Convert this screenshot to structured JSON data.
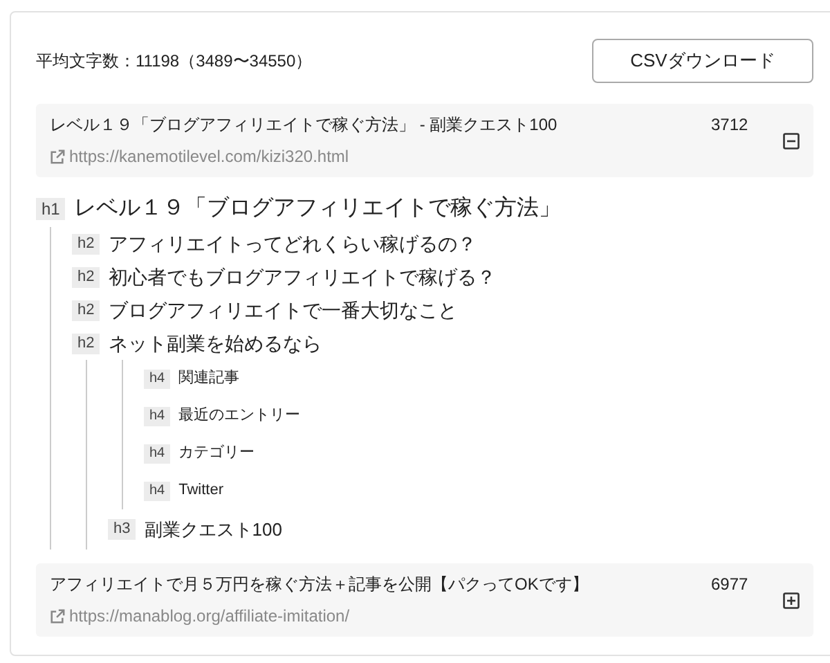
{
  "summary": "平均文字数：11198（3489〜34550）",
  "csv_button": "CSVダウンロード",
  "articles": [
    {
      "title": "レベル１９「ブログアフィリエイトで稼ぐ方法」 - 副業クエスト100",
      "url": "https://kanemotilevel.com/kizi320.html",
      "count": "3712",
      "expanded": true,
      "headings": [
        {
          "tag": "h1",
          "text": "レベル１９「ブログアフィリエイトで稼ぐ方法」",
          "children": [
            {
              "tag": "h2",
              "text": "アフィリエイトってどれくらい稼げるの？"
            },
            {
              "tag": "h2",
              "text": "初心者でもブログアフィリエイトで稼げる？"
            },
            {
              "tag": "h2",
              "text": "ブログアフィリエイトで一番大切なこと"
            },
            {
              "tag": "h2",
              "text": "ネット副業を始めるなら",
              "children": [
                {
                  "children": [
                    {
                      "tag": "h4",
                      "text": "関連記事"
                    },
                    {
                      "tag": "h4",
                      "text": "最近のエントリー"
                    },
                    {
                      "tag": "h4",
                      "text": "カテゴリー"
                    },
                    {
                      "tag": "h4",
                      "text": "Twitter"
                    }
                  ]
                },
                {
                  "tag": "h3",
                  "text": "副業クエスト100"
                }
              ]
            }
          ]
        }
      ]
    },
    {
      "title": "アフィリエイトで月５万円を稼ぐ方法＋記事を公開【パクってOKです】",
      "url": "https://manablog.org/affiliate-imitation/",
      "count": "6977",
      "expanded": false
    }
  ]
}
